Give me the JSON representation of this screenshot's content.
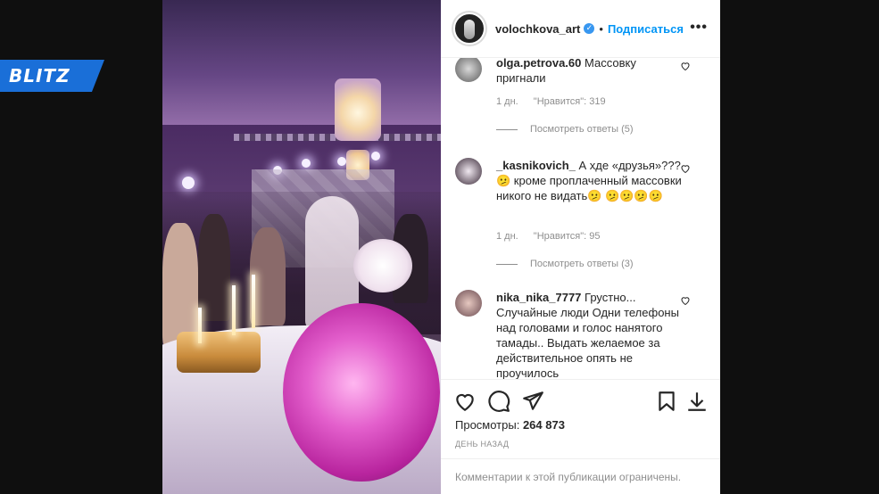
{
  "logo": {
    "text": "BLITZ"
  },
  "post": {
    "username": "volochkova_art",
    "separator": "•",
    "subscribe_label": "Подписаться",
    "more_label": "•••"
  },
  "comments": [
    {
      "username": "olga.petrova.60",
      "text": "Массовку пригнали",
      "time": "1 дн.",
      "likes": "\"Нравится\": 319",
      "replies": "Посмотреть ответы (5)"
    },
    {
      "username": "_kasnikovich_",
      "text": "А хде «друзья»??? 🫤 кроме проплаченный массовки никого не видать🫤 🫤🫤🫤🫤",
      "time": "1 дн.",
      "likes": "\"Нравится\": 95",
      "replies": "Посмотреть ответы (3)"
    },
    {
      "username": "nika_nika_7777",
      "text": "Грустно... Случайные люди Одни телефоны над головами и голос нанятого тамады.. Выдать желаемое за действительное опять не проучилось"
    }
  ],
  "stats": {
    "views_label": "Просмотры:",
    "views_value": "264 873",
    "posted_ago": "День назад"
  },
  "footer": {
    "comments_limited": "Комментарии к этой публикации ограничены."
  }
}
